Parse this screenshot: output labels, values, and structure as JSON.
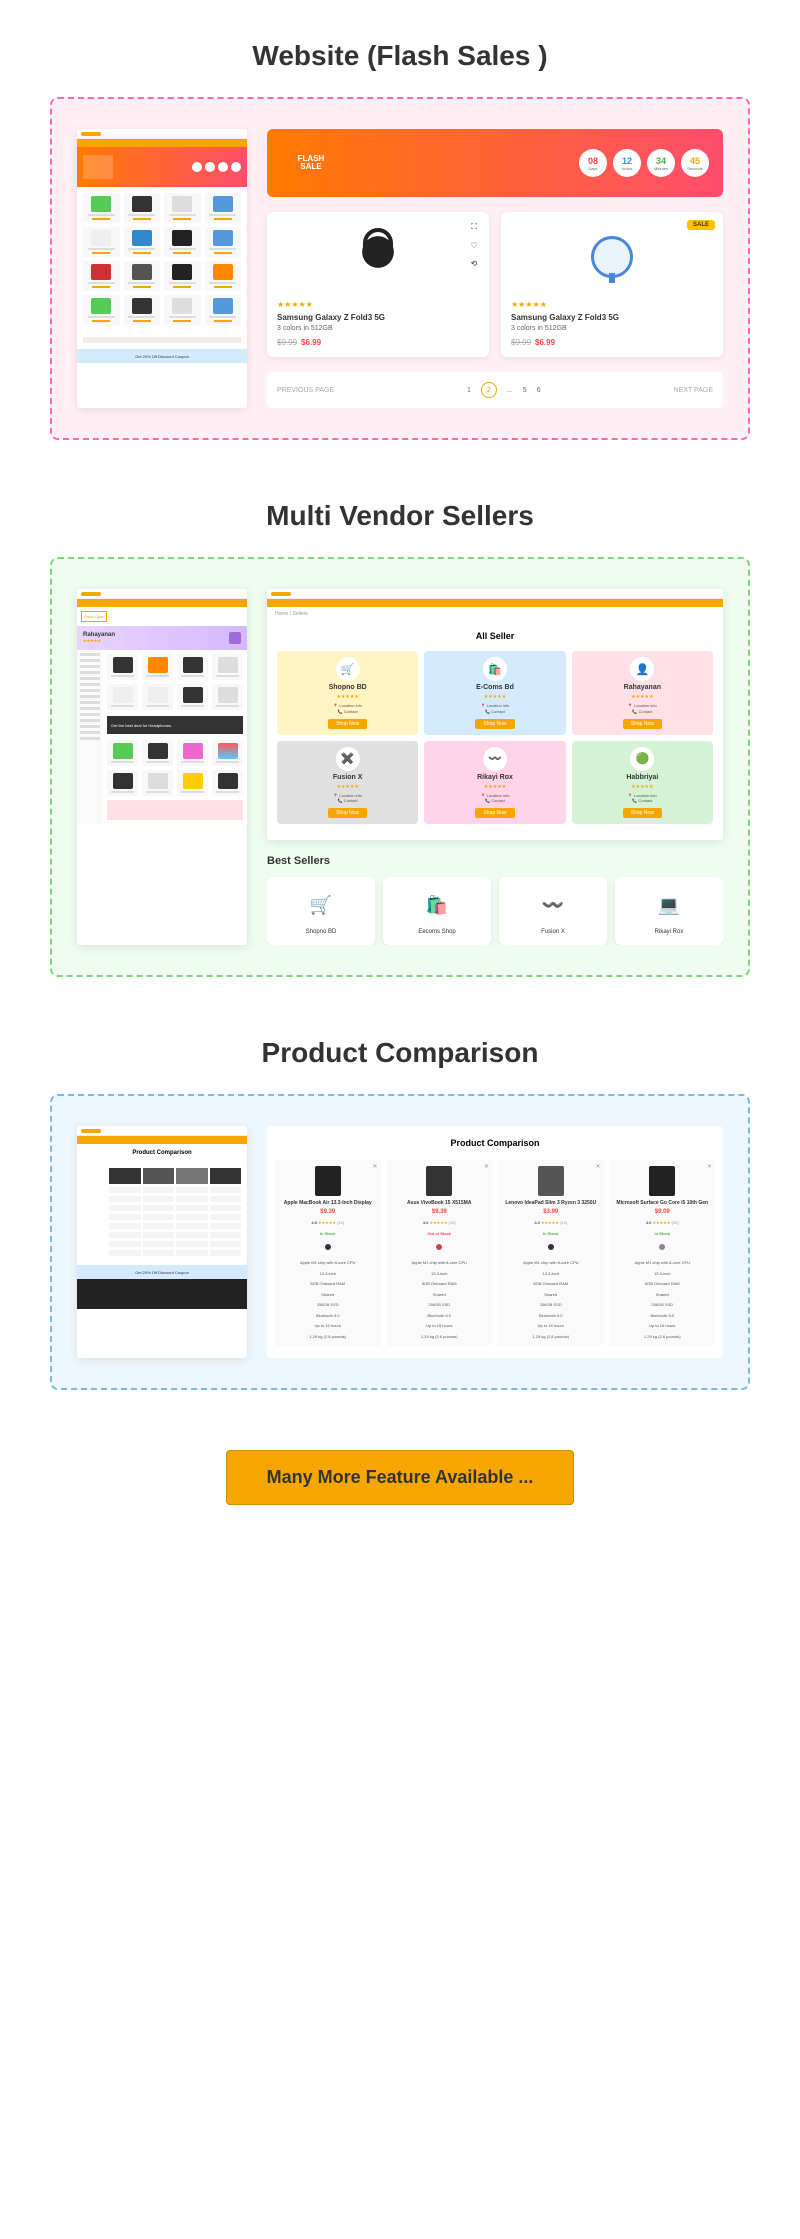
{
  "sections": {
    "flash": {
      "title": "Website (Flash Sales )"
    },
    "vendor": {
      "title": "Multi Vendor Sellers"
    },
    "compare": {
      "title": "Product Comparison"
    }
  },
  "flash_banner": {
    "label": "FLASH SALE",
    "countdown": [
      {
        "num": "08",
        "label": "Days",
        "cls": "red"
      },
      {
        "num": "12",
        "label": "Hours",
        "cls": "blue"
      },
      {
        "num": "34",
        "label": "Minutes",
        "cls": "green"
      },
      {
        "num": "45",
        "label": "Seconds",
        "cls": "orange"
      }
    ]
  },
  "flash_products": [
    {
      "title": "Samsung Galaxy Z Fold3 5G",
      "sub": "3 colors in 512GB",
      "old": "$9.99",
      "new": "$6.99",
      "img": "headset"
    },
    {
      "title": "Samsung Galaxy Z Fold3 5G",
      "sub": "3 colors in 512GB",
      "old": "$9.99",
      "new": "$6.99",
      "img": "fan",
      "badge": "SALE"
    }
  ],
  "pagination": {
    "prev": "PREVIOUS PAGE",
    "next": "NEXT PAGE",
    "pages": [
      "1",
      "2",
      "...",
      "5",
      "6"
    ]
  },
  "mock_coupon": "Get 20% Off Discount Coupon",
  "vendor_page": {
    "store_open": "Store Open",
    "name": "Rahayanan",
    "banner": "Get the best deal for Headphones"
  },
  "all_seller": {
    "title": "All Seller",
    "sellers": [
      {
        "name": "Shopno BD",
        "bg": "#fff4c4",
        "icon": "🛒",
        "btn": "Shop Now"
      },
      {
        "name": "E-Coms Bd",
        "bg": "#d4ebff",
        "icon": "🛍️",
        "btn": "Shop Now"
      },
      {
        "name": "Rahayanan",
        "bg": "#ffe0e6",
        "icon": "👤",
        "btn": "Shop Now"
      },
      {
        "name": "Fusion X",
        "bg": "#e0e0e0",
        "icon": "✖️",
        "btn": "Shop Now"
      },
      {
        "name": "Rikayi Rox",
        "bg": "#ffd4e8",
        "icon": "〰️",
        "btn": "Shop Now"
      },
      {
        "name": "Habbriyai",
        "bg": "#d4f3d4",
        "icon": "🟢",
        "btn": "Shop Now"
      }
    ]
  },
  "best_sellers": {
    "title": "Best Sellers",
    "items": [
      {
        "name": "Shopno BD",
        "icon": "🛒",
        "color": "#f7a600"
      },
      {
        "name": "Eecoms Shop",
        "icon": "🛍️",
        "color": "#2196f3"
      },
      {
        "name": "Fusion X",
        "icon": "〰️",
        "color": "#9c27b0"
      },
      {
        "name": "Rikayi Rox",
        "icon": "💻",
        "color": "#8bc34a"
      }
    ]
  },
  "comparison": {
    "title": "Product Comparison",
    "products": [
      {
        "name": "Apple MacBook Air 13.3-Inch Display",
        "price": "$9.39",
        "rating": "4.8",
        "stock": "In Stock",
        "dot": "#333"
      },
      {
        "name": "Asus VivoBook 15 X515MA",
        "price": "$9.39",
        "rating": "4.0",
        "stock": "Out of Stock",
        "dot": "#c44"
      },
      {
        "name": "Lenovo IdeaPad Slim 3 Ryzen 3 3250U",
        "price": "$3.99",
        "rating": "4.3",
        "stock": "In Stock",
        "dot": "#333"
      },
      {
        "name": "Microsoft Surface Go Core i5 10th Gen",
        "price": "$9.09",
        "rating": "4.6",
        "stock": "In Stock",
        "dot": "#888"
      }
    ]
  },
  "cta": "Many More Feature Available ..."
}
